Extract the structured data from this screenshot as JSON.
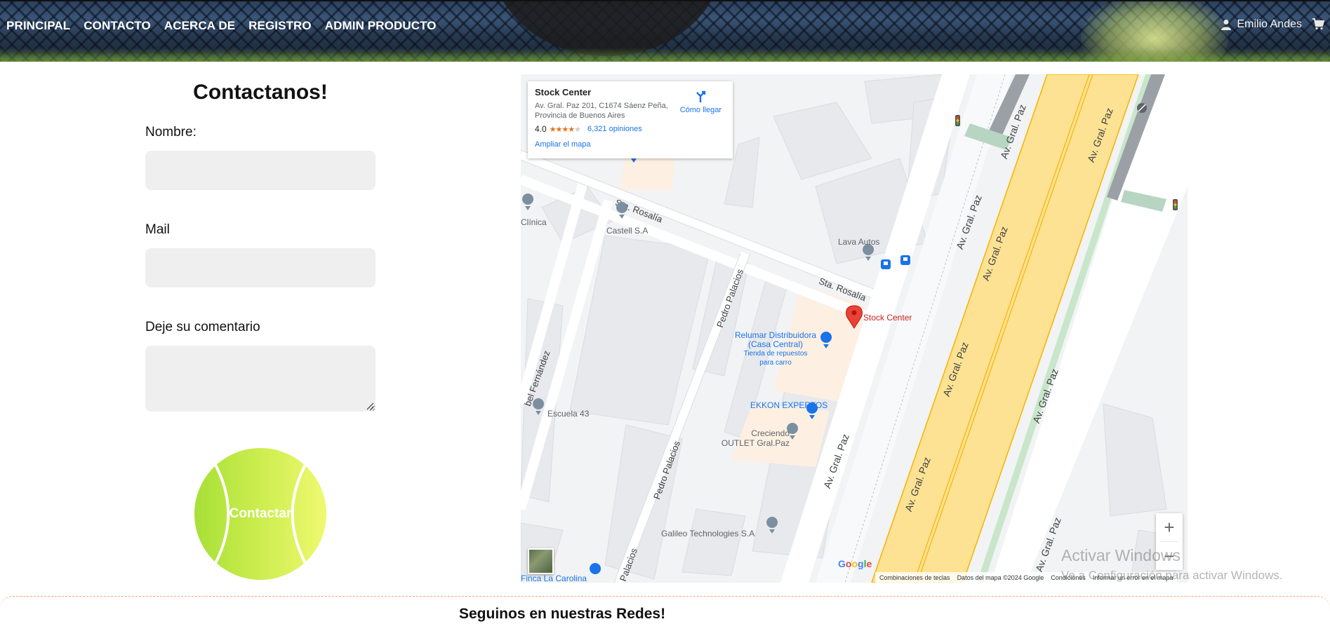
{
  "nav": {
    "items": [
      "PRINCIPAL",
      "CONTACTO",
      "ACERCA DE",
      "REGISTRO",
      "ADMIN PRODUCTO"
    ]
  },
  "user": {
    "name": "Emilio Andes",
    "icon": "user-icon",
    "cart_icon": "cart-icon"
  },
  "form": {
    "title": "Contactanos!",
    "name_label": "Nombre:",
    "name_value": "",
    "mail_label": "Mail",
    "mail_value": "",
    "comment_label": "Deje su comentario",
    "comment_value": "",
    "submit_label": "Contactar",
    "button_colors": [
      "#a7e037",
      "#eff970"
    ]
  },
  "map": {
    "place": {
      "name": "Stock Center",
      "address": "Av. Gral. Paz 201, C1674 Sáenz Peña, Provincia de Buenos Aires",
      "rating": "4.0",
      "reviews": "6,321 opiniones",
      "enlarge": "Ampliar el mapa",
      "directions": "Cómo llegar"
    },
    "labels": {
      "pin": "Stock Center",
      "sta_rosalia_1": "Sta. Rosalía",
      "sta_rosalia_2": "Sta. Rosalía",
      "pedro_1": "Pedro Palacios",
      "pedro_2": "Pedro Palacios",
      "pedro_3": "Palacios",
      "gral_paz": "Av. Gral. Paz",
      "fernandez": "bel Fernández",
      "clinica": "Clínica",
      "castell": "Castell S.A",
      "lava": "Lava Autos",
      "relumar_1": "Relumar Distribuidora",
      "relumar_2": "(Casa Central)",
      "relumar_3": "Tienda de repuestos",
      "relumar_4": "para carro",
      "ekkon": "EKKON EXPERTOS",
      "creciendo_1": "Creciendo",
      "creciendo_2": "OUTLET Gral.Paz",
      "escuela": "Escuela 43",
      "galileo": "Galileo Technologies S.A",
      "carolina": "Finca La Carolina"
    },
    "google": "Google",
    "footer": {
      "shortcuts": "Combinaciones de teclas",
      "data": "Datos del mapa ©2024 Google",
      "terms": "Condiciones",
      "report": "Informar un error en el mapa"
    },
    "zoom_in": "+",
    "zoom_out": "−",
    "road_color": "#fde293",
    "pin_color": "#ea4335",
    "poi_color": "#1a73e8"
  },
  "watermark": {
    "line1": "Activar Windows",
    "line2": "Ve a Configuración para activar Windows."
  },
  "footer": {
    "social_title": "Seguinos en nuestras Redes!"
  }
}
